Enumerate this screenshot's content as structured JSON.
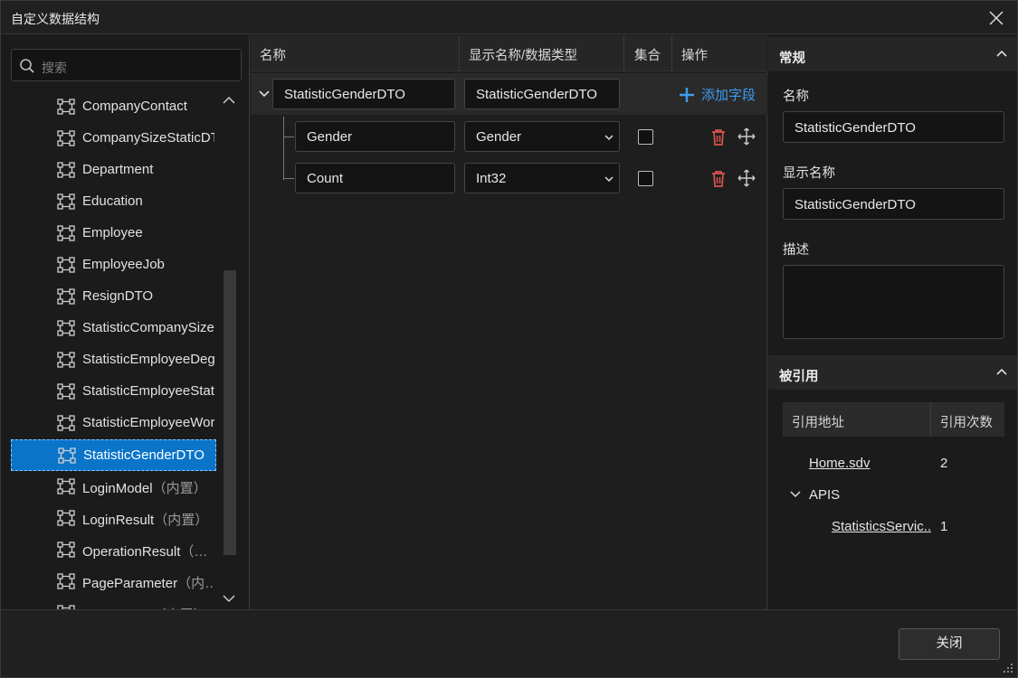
{
  "window": {
    "title": "自定义数据结构"
  },
  "search": {
    "placeholder": "搜索"
  },
  "tree": {
    "items": [
      {
        "label": "CompanyContact"
      },
      {
        "label": "CompanySizeStaticDTO"
      },
      {
        "label": "Department"
      },
      {
        "label": "Education"
      },
      {
        "label": "Employee"
      },
      {
        "label": "EmployeeJob"
      },
      {
        "label": "ResignDTO"
      },
      {
        "label": "StatisticCompanySizeDTO"
      },
      {
        "label": "StatisticEmployeeDegreeDTO"
      },
      {
        "label": "StatisticEmployeeStatusDTO"
      },
      {
        "label": "StatisticEmployeeWorkDTO"
      },
      {
        "label": "StatisticGenderDTO",
        "selected": true
      },
      {
        "label": "LoginModel",
        "suffix": "（内置）"
      },
      {
        "label": "LoginResult",
        "suffix": "（内置）"
      },
      {
        "label": "OperationResult",
        "suffix": "（…"
      },
      {
        "label": "PageParameter",
        "suffix": "（内…"
      },
      {
        "label": "PageResult",
        "suffix": "（内置）"
      }
    ]
  },
  "grid": {
    "headers": {
      "name": "名称",
      "display": "显示名称/数据类型",
      "collection": "集合",
      "ops": "操作"
    },
    "root": {
      "name": "StatisticGenderDTO",
      "display": "StatisticGenderDTO"
    },
    "add_field": "添加字段",
    "fields": [
      {
        "name": "Gender",
        "type": "Gender",
        "collection": false
      },
      {
        "name": "Count",
        "type": "Int32",
        "collection": false
      }
    ]
  },
  "props": {
    "general_title": "常规",
    "name_label": "名称",
    "name_value": "StatisticGenderDTO",
    "display_label": "显示名称",
    "display_value": "StatisticGenderDTO",
    "desc_label": "描述",
    "desc_value": "",
    "refs_title": "被引用",
    "refs_headers": {
      "address": "引用地址",
      "count": "引用次数"
    },
    "refs": [
      {
        "address": "Home.sdv",
        "count": "2"
      },
      {
        "group": "APIS"
      },
      {
        "address": "StatisticsServic...",
        "count": "1"
      }
    ]
  },
  "footer": {
    "close": "关闭"
  },
  "colors": {
    "accent": "#0a74c9",
    "link_add": "#3d9cf0",
    "delete": "#d9534f"
  }
}
